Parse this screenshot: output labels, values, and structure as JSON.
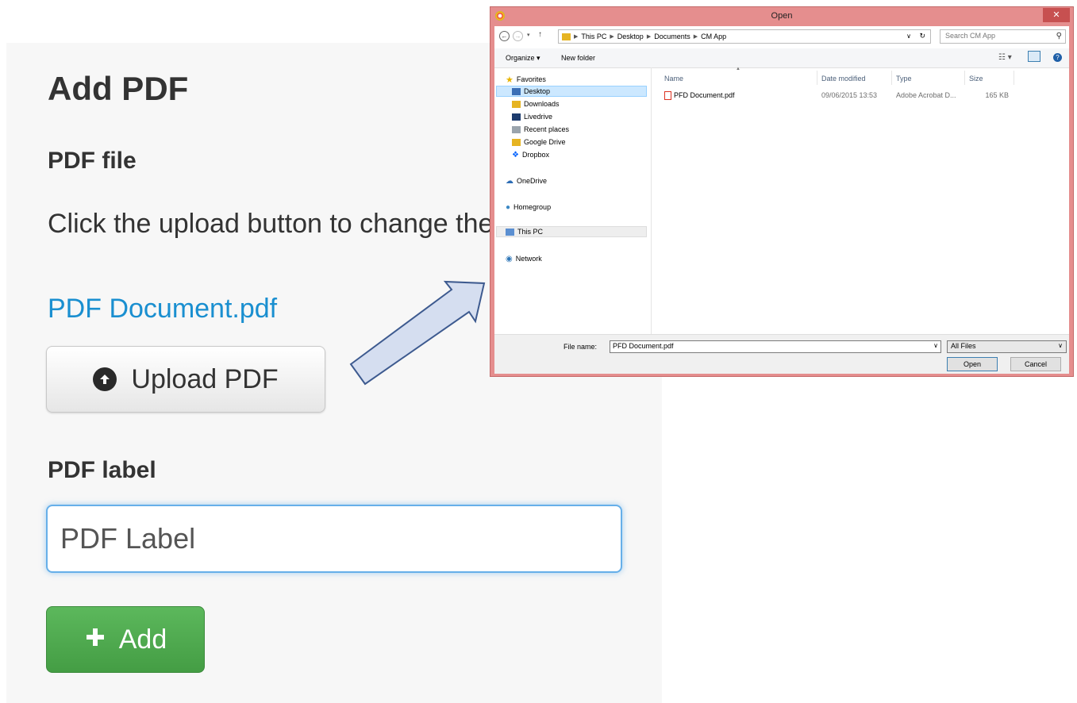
{
  "form": {
    "title": "Add PDF",
    "pdf_file_heading": "PDF file",
    "help_text": "Click the upload button to change the PDF",
    "current_file": "PDF Document.pdf",
    "upload_button": "Upload PDF",
    "label_heading": "PDF label",
    "label_value": "PDF Label",
    "add_button": "Add"
  },
  "dialog": {
    "title": "Open",
    "close": "✕",
    "breadcrumbs": [
      "This PC",
      "Desktop",
      "Documents",
      "CM App"
    ],
    "search_placeholder": "Search CM App",
    "toolbar": {
      "organize": "Organize ▾",
      "new_folder": "New folder"
    },
    "nav": {
      "favorites": "Favorites",
      "items": [
        "Desktop",
        "Downloads",
        "Livedrive",
        "Recent places",
        "Google Drive",
        "Dropbox"
      ],
      "onedrive": "OneDrive",
      "homegroup": "Homegroup",
      "this_pc": "This PC",
      "network": "Network"
    },
    "columns": {
      "name": "Name",
      "date": "Date modified",
      "type": "Type",
      "size": "Size"
    },
    "files": [
      {
        "name": "PFD Document.pdf",
        "date": "09/06/2015 13:53",
        "type": "Adobe Acrobat D...",
        "size": "165 KB"
      }
    ],
    "file_name_label": "File name:",
    "file_name_value": "PFD Document.pdf",
    "file_type": "All Files",
    "open_button": "Open",
    "cancel_button": "Cancel"
  },
  "colors": {
    "link": "#1a8fd0",
    "add_green": "#5cb85c",
    "dialog_border": "#e58e8e",
    "focus_blue": "#66afe9"
  }
}
